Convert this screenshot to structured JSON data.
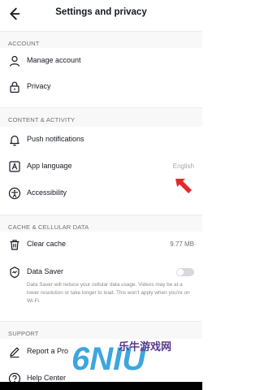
{
  "header": {
    "title": "Settings and privacy"
  },
  "sections": {
    "account": "ACCOUNT",
    "content": "CONTENT & ACTIVITY",
    "cache": "CACHE & CELLULAR DATA",
    "support": "SUPPORT"
  },
  "account": {
    "manage": "Manage account",
    "privacy": "Privacy"
  },
  "content": {
    "push": "Push notifications",
    "language": "App language",
    "language_value": "English",
    "accessibility": "Accessibility"
  },
  "cache": {
    "clear": "Clear cache",
    "clear_size": "9.77 MB",
    "saver": "Data Saver",
    "saver_on": false,
    "saver_desc": "Data Saver will reduce your cellular data usage. Videos may be at a lower resolution or take longer to load. This won't apply when you're on Wi-Fi."
  },
  "support": {
    "report": "Report a Pro",
    "help": "Help Center"
  },
  "watermark": {
    "text": "乐牛游戏网",
    "logo": "6NIU"
  },
  "colors": {
    "accent_arrow": "#e8262b",
    "section_bg": "#f8f8f8"
  }
}
